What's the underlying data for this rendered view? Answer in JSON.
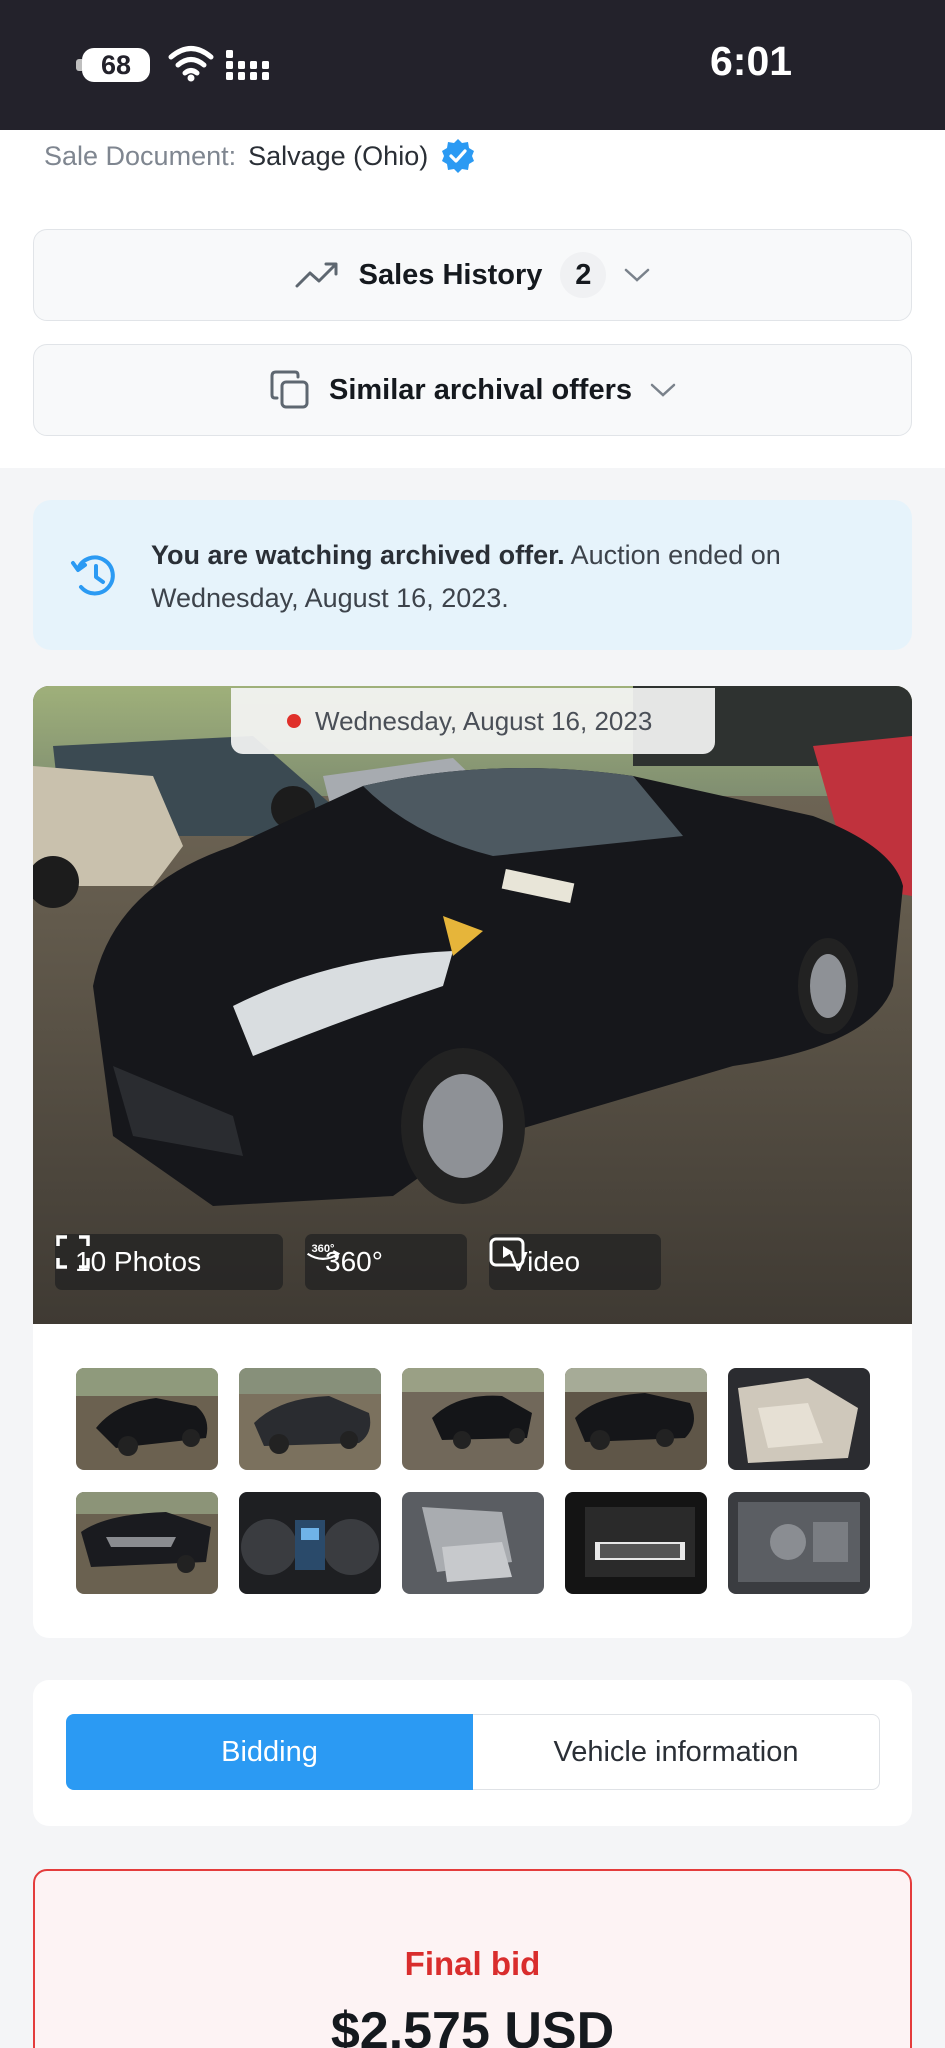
{
  "status_bar": {
    "battery": "68",
    "time": "6:01"
  },
  "sale_document": {
    "label": "Sale Document:",
    "value": "Salvage (Ohio)"
  },
  "sales_history": {
    "label": "Sales History",
    "count": "2"
  },
  "similar_offers": {
    "label": "Similar archival offers"
  },
  "archived_notice": {
    "bold": "You are watching archived offer.",
    "text": " Auction ended on Wednesday, August 16, 2023."
  },
  "gallery": {
    "date": "Wednesday, August 16, 2023",
    "photos_label": "10 Photos",
    "view360_label": "360°",
    "video_label": "Video",
    "thumbnail_count": 10
  },
  "tabs": [
    {
      "label": "Bidding",
      "active": true
    },
    {
      "label": "Vehicle information",
      "active": false
    }
  ],
  "final_bid": {
    "label": "Final bid",
    "amount": "$2,575 USD"
  },
  "colors": {
    "accent": "#2b9af3",
    "danger": "#e43c3c",
    "status_bar": "#23222b",
    "notice_bg": "#e6f3fb"
  }
}
